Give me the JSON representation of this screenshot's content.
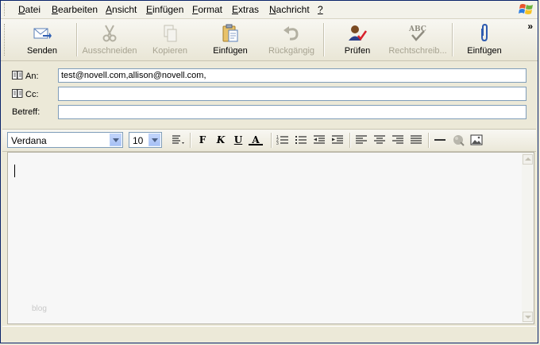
{
  "menu": {
    "items": [
      {
        "label": "Datei",
        "underline": "D",
        "rest": "atei"
      },
      {
        "label": "Bearbeiten",
        "underline": "B",
        "rest": "earbeiten"
      },
      {
        "label": "Ansicht",
        "underline": "A",
        "rest": "nsicht"
      },
      {
        "label": "Einfügen",
        "underline": "E",
        "rest": "infügen"
      },
      {
        "label": "Format",
        "underline": "F",
        "rest": "ormat"
      },
      {
        "label": "Extras",
        "underline": "E",
        "rest": "xtras"
      },
      {
        "label": "Nachricht",
        "underline": "N",
        "rest": "achricht"
      },
      {
        "label": "?",
        "underline": "?",
        "rest": ""
      }
    ]
  },
  "toolbar": {
    "send": "Senden",
    "cut": "Ausschneiden",
    "copy": "Kopieren",
    "paste": "Einfügen",
    "undo": "Rückgängig",
    "check": "Prüfen",
    "spelling": "Rechtschreib...",
    "attach": "Einfügen",
    "overflow": "»"
  },
  "header": {
    "to_label": "An:",
    "to_value": "test@novell.com,allison@novell.com,",
    "cc_label": "Cc:",
    "cc_value": "",
    "subject_label": "Betreff:",
    "subject_value": ""
  },
  "format": {
    "font": "Verdana",
    "size": "10",
    "bold": "F",
    "italic": "K",
    "underline": "U",
    "fontcolor": "A"
  },
  "editor": {
    "watermark": "blog"
  },
  "colors": {
    "accent": "#0a246a",
    "input_border": "#7f9db9",
    "disabled_text": "#a7a391"
  }
}
